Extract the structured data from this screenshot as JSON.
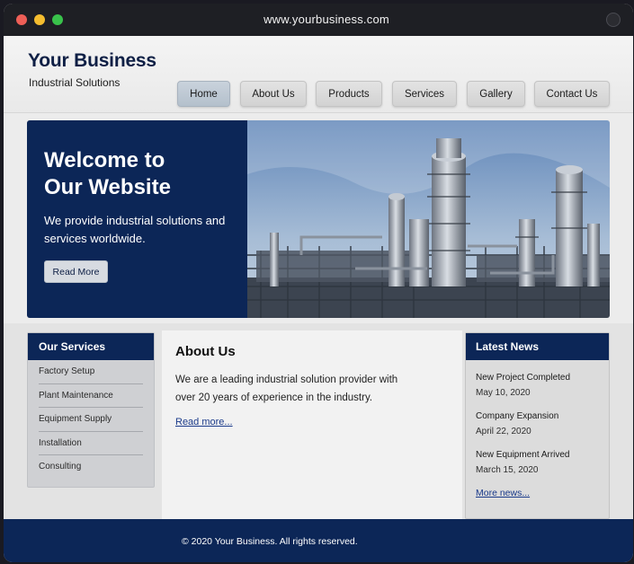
{
  "browser": {
    "url": "www.yourbusiness.com"
  },
  "brand": {
    "title": "Your Business",
    "subtitle": "Industrial Solutions"
  },
  "nav": {
    "items": [
      {
        "label": "Home",
        "active": true
      },
      {
        "label": "About Us"
      },
      {
        "label": "Products"
      },
      {
        "label": "Services"
      },
      {
        "label": "Gallery"
      },
      {
        "label": "Contact Us"
      }
    ]
  },
  "hero": {
    "title_line1": "Welcome to",
    "title_line2": "Our Website",
    "text": "We provide industrial solutions and services worldwide.",
    "button": "Read More",
    "image_icon": "industrial-plant-image"
  },
  "services": {
    "heading": "Our Services",
    "items": [
      "Factory Setup",
      "Plant Maintenance",
      "Equipment Supply",
      "Installation",
      "Consulting"
    ]
  },
  "about": {
    "heading": "About Us",
    "text": "We are a leading industrial solution provider with over 20 years of experience in the industry.",
    "link": "Read more..."
  },
  "news": {
    "heading": "Latest News",
    "items": [
      {
        "title": "New Project Completed",
        "date": "May 10, 2020"
      },
      {
        "title": "Company Expansion",
        "date": "April 22, 2020"
      },
      {
        "title": "New Equipment Arrived",
        "date": "March 15, 2020"
      }
    ],
    "more": "More news..."
  },
  "footer": {
    "text": "© 2020 Your Business. All rights reserved."
  },
  "colors": {
    "primary": "#0c2657",
    "link": "#1a3a8a",
    "nav_active": "#b4c0cc"
  }
}
